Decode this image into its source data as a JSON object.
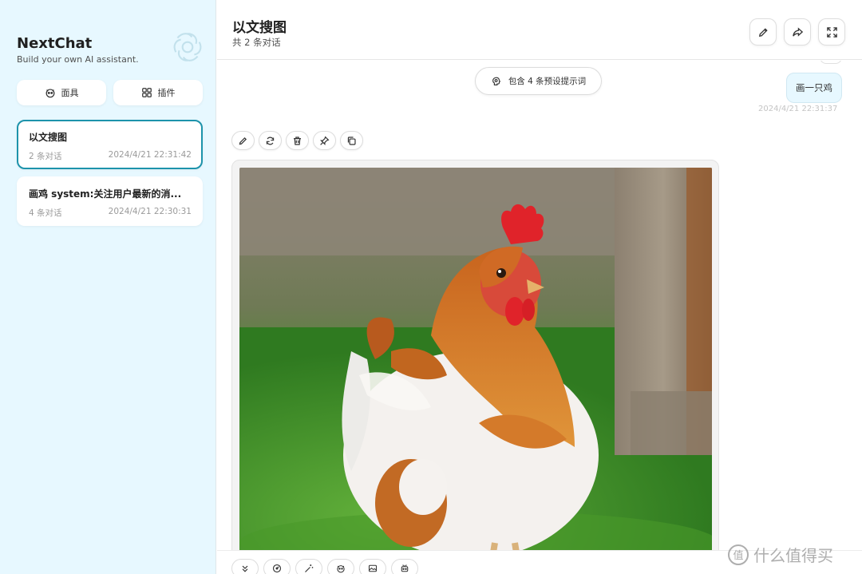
{
  "sidebar": {
    "brand_title": "NextChat",
    "brand_subtitle": "Build your own AI assistant.",
    "buttons": [
      {
        "label": "面具",
        "icon": "mask-icon"
      },
      {
        "label": "插件",
        "icon": "plugin-grid-icon"
      }
    ],
    "chats": [
      {
        "title": "以文搜图",
        "count": "2 条对话",
        "time": "2024/4/21 22:31:42",
        "active": true
      },
      {
        "title": "画鸡 system:关注用户最新的消...",
        "count": "4 条对话",
        "time": "2024/4/21 22:30:31",
        "active": false
      }
    ]
  },
  "header": {
    "title": "以文搜图",
    "subtitle": "共 2 条对话",
    "buttons": [
      "edit-icon",
      "share-icon",
      "fullscreen-icon"
    ]
  },
  "chat": {
    "prompt_pill": "包含 4 条预设提示词",
    "user_message": "画一只鸡",
    "user_time": "2024/4/21 22:31:37",
    "message_actions": [
      "edit-icon",
      "refresh-icon",
      "delete-icon",
      "pin-icon",
      "copy-icon"
    ]
  },
  "toolbar": {
    "tools": [
      "collapse-down-icon",
      "settings-gauge-icon",
      "magic-wand-icon",
      "mask-icon",
      "image-icon",
      "robot-icon"
    ]
  },
  "watermark": {
    "symbol": "值",
    "text": "什么值得买"
  }
}
